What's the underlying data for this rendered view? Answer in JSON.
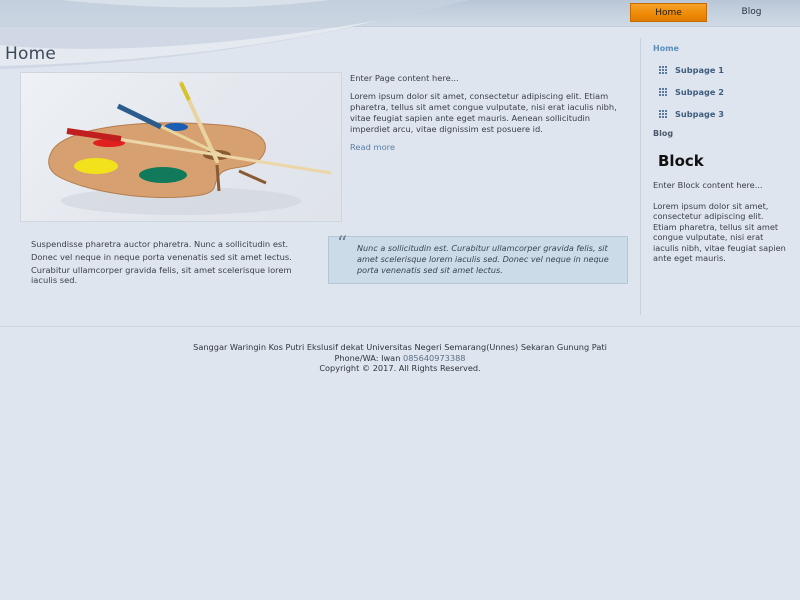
{
  "nav": {
    "items": [
      {
        "label": "Home",
        "active": true
      },
      {
        "label": "Blog",
        "active": false
      }
    ]
  },
  "main": {
    "title": "Home",
    "hero_image": "paint-palette-with-brushes",
    "intro": "Enter Page content here...",
    "paragraph": "Lorem ipsum dolor sit amet, consectetur adipiscing elit. Etiam pharetra, tellus sit amet congue vulputate, nisi erat iaculis nibh, vitae feugiat sapien ante eget mauris. Aenean sollicitudin imperdiet arcu, vitae dignissim est posuere id.",
    "read_more": "Read more",
    "list": [
      "Suspendisse pharetra auctor pharetra. Nunc a sollicitudin est.",
      "Donec vel neque in neque porta venenatis sed sit amet lectus.",
      "Curabitur ullamcorper gravida felis, sit amet scelerisque lorem iaculis sed."
    ],
    "quote": "Nunc a sollicitudin est. Curabitur ullamcorper gravida felis, sit amet scelerisque lorem iaculis sed. Donec vel neque in neque porta venenatis sed sit amet lectus."
  },
  "sidebar": {
    "home": "Home",
    "subpages": [
      "Subpage 1",
      "Subpage 2",
      "Subpage 3"
    ],
    "blog": "Blog",
    "block_title": "Block",
    "block_intro": "Enter Block content here...",
    "block_text": "Lorem ipsum dolor sit amet, consectetur adipiscing elit. Etiam pharetra, tellus sit amet congue vulputate, nisi erat iaculis nibh, vitae feugiat sapien ante eget mauris."
  },
  "footer": {
    "line1": "Sanggar Waringin Kos Putri Ekslusif dekat Universitas Negeri Semarang(Unnes) Sekaran Gunung Pati",
    "phone_prefix": "Phone/WA: Iwan",
    "phone": "085640973388",
    "copyright": "Copyright © 2017. All Rights Reserved."
  },
  "colors": {
    "accent": "#ee8a05",
    "link": "#5a8fbf",
    "background": "#dfe5ee"
  }
}
